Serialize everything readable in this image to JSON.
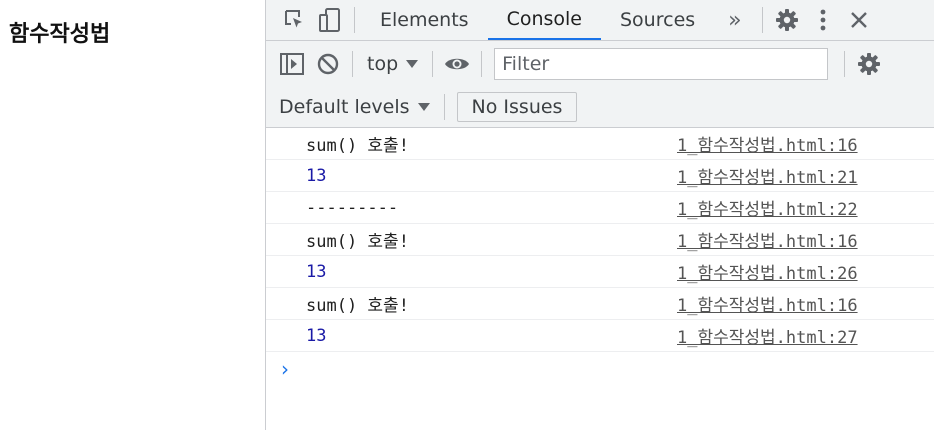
{
  "page": {
    "heading": "함수작성법"
  },
  "devtools": {
    "tabs": [
      {
        "label": "Elements",
        "active": false
      },
      {
        "label": "Console",
        "active": true
      },
      {
        "label": "Sources",
        "active": false
      }
    ],
    "more_tabs_label": "»",
    "toolbar": {
      "context": "top",
      "filter_placeholder": "Filter"
    },
    "levels": {
      "label": "Default levels",
      "issues_label": "No Issues"
    },
    "messages": [
      {
        "text": "sum() 호출!",
        "kind": "log",
        "source": "1_함수작성법.html:16"
      },
      {
        "text": "13",
        "kind": "number",
        "source": "1_함수작성법.html:21"
      },
      {
        "text": "---------",
        "kind": "log",
        "source": "1_함수작성법.html:22"
      },
      {
        "text": "sum() 호출!",
        "kind": "log",
        "source": "1_함수작성법.html:16"
      },
      {
        "text": "13",
        "kind": "number",
        "source": "1_함수작성법.html:26"
      },
      {
        "text": "sum() 호출!",
        "kind": "log",
        "source": "1_함수작성법.html:16"
      },
      {
        "text": "13",
        "kind": "number",
        "source": "1_함수작성법.html:27"
      }
    ],
    "prompt_glyph": "›",
    "colors": {
      "accent": "#1a73e8",
      "number": "#1a1aa6",
      "panel_bg": "#f1f3f4"
    }
  }
}
